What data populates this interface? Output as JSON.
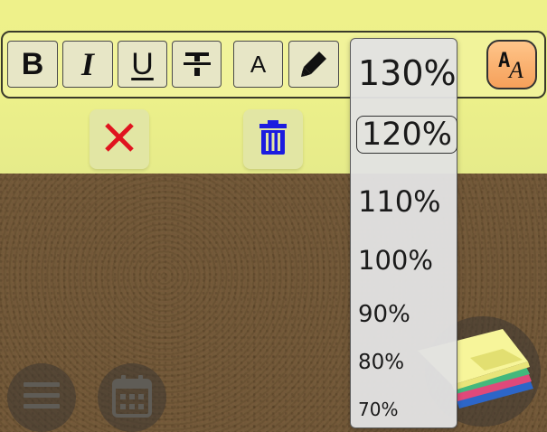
{
  "toolbar": {
    "buttons": [
      {
        "label": "B",
        "name": "bold"
      },
      {
        "label": "I",
        "name": "italic"
      },
      {
        "label": "U",
        "name": "underline"
      },
      {
        "label": "",
        "name": "strikethrough"
      },
      {
        "label": "A",
        "name": "text-color"
      },
      {
        "label": "",
        "name": "highlight"
      }
    ],
    "font_button": {
      "label_top": "A",
      "label_bottom": "A"
    }
  },
  "actions": {
    "close_icon": "close-icon",
    "trash_icon": "trash-icon"
  },
  "dropdown": {
    "options": [
      "130%",
      "120%",
      "110%",
      "100%",
      "90%",
      "80%",
      "70%"
    ],
    "selected": "120%"
  },
  "colors": {
    "toolbar_bg": "#f1f39a",
    "close": "#e0141e",
    "trash": "#1c1ce0",
    "font_button": "#f7b070",
    "cork": "#6e5535"
  }
}
